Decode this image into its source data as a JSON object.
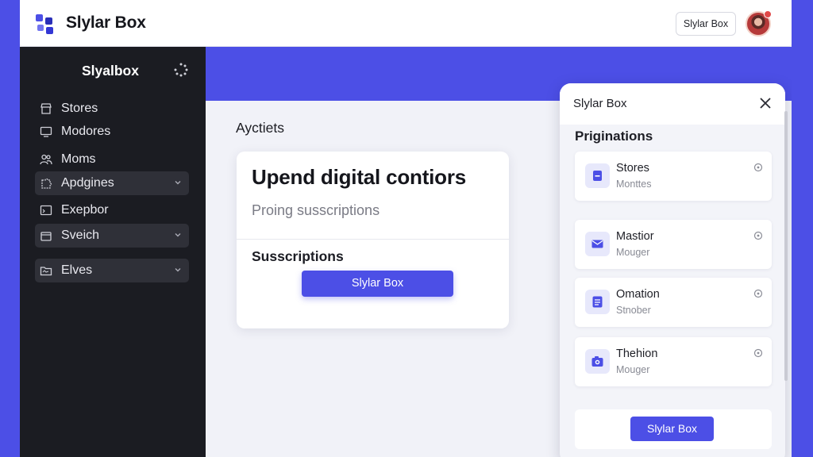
{
  "header": {
    "app_title": "Slylar Box",
    "button_label": "Slylar Box",
    "notification_count": "!"
  },
  "sidebar": {
    "title": "Slyalbox",
    "items": [
      {
        "label": "Stores",
        "icon": "store-icon",
        "dropdown": false
      },
      {
        "label": "Modores",
        "icon": "monitor-icon",
        "dropdown": false
      },
      {
        "label": "Moms",
        "icon": "people-icon",
        "dropdown": false
      },
      {
        "label": "Apdgines",
        "icon": "puzzle-icon",
        "dropdown": true
      },
      {
        "label": "Exepbor",
        "icon": "terminal-icon",
        "dropdown": false
      },
      {
        "label": "Sveich",
        "icon": "box-icon",
        "dropdown": true
      },
      {
        "label": "Elves",
        "icon": "folder-icon",
        "dropdown": true
      }
    ]
  },
  "main": {
    "section_title": "Ayctiets",
    "card": {
      "heading": "Upend digital contiors",
      "subtitle": "Proing susscriptions",
      "label": "Susscriptions",
      "button_label": "Slylar Box"
    }
  },
  "panel": {
    "title": "Slylar Box",
    "subtitle": "Priginations",
    "items": [
      {
        "title": "Stores",
        "subtitle": "Monttes",
        "icon": "document-icon"
      },
      {
        "title": "Mastior",
        "subtitle": "Mouger",
        "icon": "mail-icon"
      },
      {
        "title": "Omation",
        "subtitle": "Stnober",
        "icon": "list-icon"
      },
      {
        "title": "Thehion",
        "subtitle": "Mouger",
        "icon": "camera-icon"
      }
    ],
    "button_label": "Slylar Box"
  },
  "colors": {
    "accent": "#4c4fe6",
    "sidebar_bg": "#1b1c22",
    "sidebar_dropdown_bg": "#2f3038",
    "background": "#f1f2f8"
  }
}
